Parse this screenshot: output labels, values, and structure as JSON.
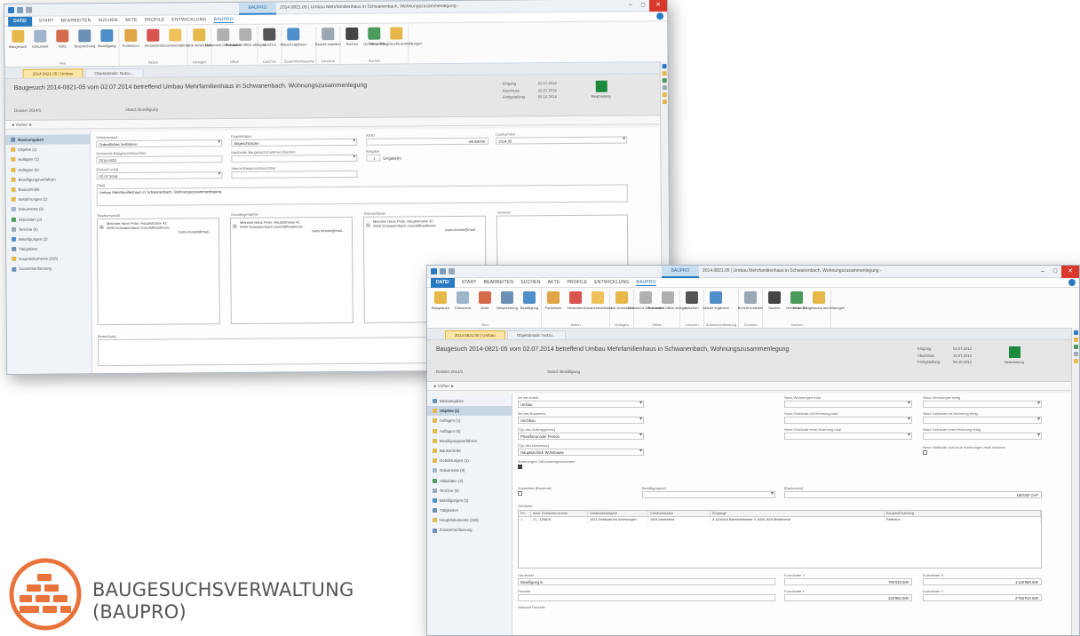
{
  "brand": {
    "line1": "BAUGESUCHSVERWALTUNG",
    "line2": "(BAUPRO)"
  },
  "colors": {
    "accent": "#2b7bc0",
    "logo": "#e8743b",
    "status": "#1c8a3c",
    "active_doc_tab": "#fbe6a6"
  },
  "window": {
    "title": "2014.0821.05 | Umbau Mehrfamilienhaus in Schwanenbach, Wohnungszusammenlegung - ",
    "ctx_tab": "BAUPRO",
    "ctrl_min": "–",
    "ctrl_max": "□",
    "ctrl_close": "✕"
  },
  "ribbon": {
    "file_tab": "DATEI",
    "tabs": [
      "START",
      "BEARBEITEN",
      "SUCHEN",
      "AKTE",
      "PROFILE",
      "ENTWICKLUNG",
      "BAUPRO"
    ],
    "groups": [
      {
        "label": "Neu",
        "buttons": [
          {
            "label": "Baugesuch",
            "icon": "folder-icon",
            "color": "#e6b84a"
          },
          {
            "label": "Dokument",
            "icon": "document-icon",
            "color": "#9fb5cc"
          },
          {
            "label": "Notiz",
            "icon": "note-icon",
            "color": "#d36b4a"
          },
          {
            "label": "Besprechung",
            "icon": "meeting-icon",
            "color": "#6b8fb5"
          },
          {
            "label": "Bewilligung",
            "icon": "approval-icon",
            "color": "#4f8fc9"
          }
        ]
      },
      {
        "label": "Aktion",
        "buttons": [
          {
            "label": "Fortsetzen",
            "icon": "continue-icon",
            "color": "#e0a545"
          },
          {
            "label": "Versenden",
            "icon": "send-icon",
            "color": "#d9534f"
          },
          {
            "label": "Zusammenführen",
            "icon": "merge-icon",
            "color": "#f0c05a"
          }
        ]
      },
      {
        "label": "Vorlagen",
        "buttons": [
          {
            "label": "Link verwenden",
            "icon": "link-icon",
            "color": "#e6b84a"
          }
        ]
      },
      {
        "label": "Office",
        "buttons": [
          {
            "label": "Dokument Office laden",
            "icon": "word-icon",
            "color": "#b0b0b0"
          },
          {
            "label": "Dokument Office ablegen",
            "icon": "word-save-icon",
            "color": "#b0b0b0"
          }
        ]
      },
      {
        "label": "Löschen",
        "buttons": [
          {
            "label": "Löschen",
            "icon": "delete-icon",
            "color": "#555555"
          }
        ]
      },
      {
        "label": "Zusammenfassung",
        "buttons": [
          {
            "label": "Aktuell ergänzen",
            "icon": "update-icon",
            "color": "#4f8fc9"
          }
        ]
      },
      {
        "label": "Drucken",
        "buttons": [
          {
            "label": "Bericht erstellen",
            "icon": "report-icon",
            "color": "#9aa7b4"
          }
        ]
      },
      {
        "label": "Suchen",
        "buttons": [
          {
            "label": "Suchen",
            "icon": "binoculars-icon",
            "color": "#444444"
          },
          {
            "label": "Gebiet in GIS",
            "icon": "map-icon",
            "color": "#4a9b5c"
          },
          {
            "label": "Neue Baugesuchs-anmeldungen",
            "icon": "new-folder-icon",
            "color": "#e6b84a"
          }
        ]
      }
    ]
  },
  "doc_tabs": [
    "2014.0821.05 | Umbau",
    "Objektdetails: Nutzu..."
  ],
  "header": {
    "title": "Baugesuch 2014-0821-05 vom 02.07.2014 betreffend Umbau Mehrfamilienhaus in Schwanenbach, Wohnungszusammenlegung",
    "dossier": "Dossier 2014/1",
    "stand": "Stand: Bewilligung",
    "meta_labels": [
      "Eingang",
      "Abschluss",
      "Fertigstellung"
    ],
    "meta_values": [
      "02.07.2014",
      "10.07.2014",
      "05.10.2014"
    ],
    "status_label": "Bearbeitung"
  },
  "subbar": "◄ Vorher ►",
  "nav_items": [
    {
      "label": "Basisangaben",
      "color": "#6b8fb5"
    },
    {
      "label": "Objekte (1)",
      "color": "#e6b84a"
    },
    {
      "label": "Auflagen (1)",
      "color": "#e6b84a"
    },
    {
      "label": "Auflagen (6)",
      "color": "#e6b84a"
    },
    {
      "label": "Bewilligungsverfahren",
      "color": "#e6b84a"
    },
    {
      "label": "Baukontrolle",
      "color": "#e6b84a"
    },
    {
      "label": "Gebührungen (1)",
      "color": "#e6b84a"
    },
    {
      "label": "Dokumente (9)",
      "color": "#9fb5cc"
    },
    {
      "label": "Aktivitäten (3)",
      "color": "#4a9b5c"
    },
    {
      "label": "Termine (0)",
      "color": "#9aa7b4"
    },
    {
      "label": "Beteiligungen (2)",
      "color": "#4f8fc9"
    },
    {
      "label": "Tätigkeiten",
      "color": "#6b8fb5"
    },
    {
      "label": "Hauptdokumente (226)",
      "color": "#e6b84a"
    },
    {
      "label": "Zusammenfassung",
      "color": "#6b8fb5"
    }
  ],
  "form1": {
    "verfahren_label": "Verfahrensart",
    "verfahren_value": "Ordentliches Verfahren",
    "projektstatus_label": "Projektstatus",
    "projektstatus_value": "Abgeschlossen",
    "egid_label": "EGID",
    "egid_value": "04054000",
    "laufnummer_label": "Laufnummer",
    "laufnummer_value": "2014.05",
    "gesuchsnr_label": "Gemeinde Baugesuchsnummer",
    "gesuchsnr_value": "2014-0821",
    "baumassnr_label": "Kantonale Baugesuchsnummer (Kanton)",
    "eingabe_label": "Eingabe",
    "eingabe_value": "1",
    "eingabe_suffix": "Eingabe(n)",
    "eingang_label": "[Gesuch vom]",
    "eingang_value": "02.07.2014",
    "intern_label": "Interne Baugesuchsnummer",
    "titel_label": "[Titel]",
    "titel_value": "Umbau Mehrfamilienhaus in Schwanenbach, Wohnungszusammenlegung",
    "bauherr_label": "Bauherrschaft",
    "grund_label": "Grundeigentümer",
    "planverf_label": "Planverfasser",
    "vertreter_label": "Vertreter",
    "addr_l1": "Meinster Hans Peter, Hauptstrasse 42",
    "addr_l2": "9999 Schwanenbach Geschäftsadresse",
    "addr_mail": "hans.muster@mail...",
    "bemerkung_label": "Bemerkung"
  },
  "form2": {
    "art_bauobjekt_label": "Art der Arbeit",
    "art_bauobjekt_value": "Umbau",
    "art_bauwerk_label": "Art des Bauwerks",
    "art_bauwerk_value": "Hochbau",
    "auftraggeber_label": "[Typ des Auftraggebers]",
    "auftraggeber_value": "Privatfirma oder Person",
    "bauwerkart_label": "[Typ des Bauwerks]",
    "bauwerkart_value": "Hauptsächlich Wohnbaute",
    "ch1_label": "Änderungen Gebäudeeigenschaften",
    "neue_whg_label": "Neue Wohnungen total",
    "neue_geb_label": "Neue Gebäude mit Wohnung total",
    "neue_ohne_label": "Neue Gebäude ohne Wohnung total",
    "whg_fertig_label": "Neue Wohnungen fertig",
    "geb_fertig_label": "Neue Gebäude mit Wohnung fertig",
    "ohne_fertig_label": "Neue Gebäude ohne Wohnung fertig",
    "chk_neu_label": "Neue Gebäude und neue Wohnungen nicht bekannt",
    "zusatz_label": "Zusatzfeld (Bauende)",
    "bewilligung_label": "Bewilligungsart",
    "baukosten_label": "[Baukosten]",
    "baukosten_value": "180'000 CHF",
    "gebaeude_label": "Gebäude",
    "grid_headers": [
      "Pri.",
      "Amtl. Gebäudenummer",
      "Gebäudekategorie",
      "Gebäudestatus",
      "Eingänge",
      "Baujahr/Erstellung"
    ],
    "grid_row": [
      "✓",
      "17_ 125876",
      "1021 Gebäude mit Wohnungen",
      "1004 bestehend",
      "4 1208418 Bahnhofstrasse 3, 6020 1004 Bestehend",
      "Referenz"
    ],
    "gemeinde_label": "Gemeinde",
    "gemeinde_value": "Bewilligung B",
    "parzelle_label": "Parzelle",
    "parzelle_value": "",
    "standort_label": "Standort Parzelle",
    "koord_a_label": "Koordinate X",
    "koord_a_value": "790'030.000",
    "koord_b_label": "Koordinate Y",
    "koord_b_value": "220'960.000",
    "koord_c_label": "Koordinate X",
    "koord_c_value": "1'120'980.000",
    "koord_d_label": "Koordinate Y",
    "koord_d_value": "2'760'010.000"
  }
}
